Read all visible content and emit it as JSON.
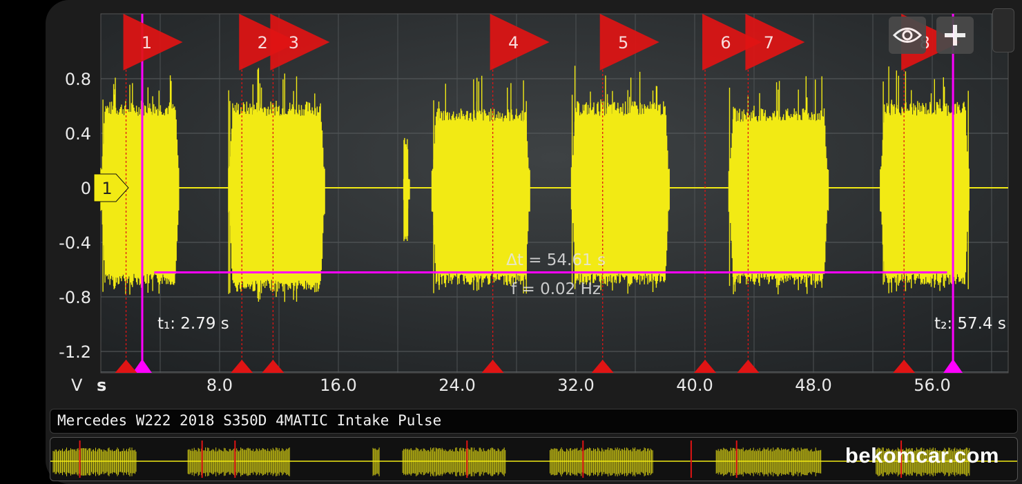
{
  "chart_data": {
    "type": "line",
    "subtype": "oscilloscope",
    "title": "Mercedes W222 2018 S350D 4MATIC Intake Pulse",
    "y_unit": "V",
    "x_unit": "s",
    "ylim": [
      -1.4,
      1.25
    ],
    "xlim": [
      0,
      61
    ],
    "y_ticks": [
      0.8,
      0.4,
      0,
      -0.4,
      -0.8,
      -1.2
    ],
    "y_tick_labels": [
      "0.8",
      "0.4",
      "0",
      "-0.4",
      "-0.8",
      "-1.2"
    ],
    "x_ticks": [
      8,
      16,
      24,
      32,
      40,
      48,
      56
    ],
    "x_tick_labels": [
      "8.0",
      "16.0",
      "24.0",
      "32.0",
      "40.0",
      "48.0",
      "56.0"
    ],
    "grid": true,
    "series_color": "#f2ea14",
    "baseline_offset": 0,
    "bursts": [
      {
        "start": 0,
        "end": 5.3,
        "amplitude_pos": 0.6,
        "amplitude_neg": -0.7
      },
      {
        "start": 8.6,
        "end": 15.1,
        "amplitude_pos": 0.6,
        "amplitude_neg": -0.75
      },
      {
        "start": 20.4,
        "end": 20.8,
        "amplitude_pos": 0.25,
        "amplitude_neg": -0.35
      },
      {
        "start": 22.3,
        "end": 28.9,
        "amplitude_pos": 0.55,
        "amplitude_neg": -0.7
      },
      {
        "start": 31.7,
        "end": 38.3,
        "amplitude_pos": 0.6,
        "amplitude_neg": -0.7
      },
      {
        "start": 42.3,
        "end": 49.0,
        "amplitude_pos": 0.55,
        "amplitude_neg": -0.7
      },
      {
        "start": 52.5,
        "end": 58.5,
        "amplitude_pos": 0.6,
        "amplitude_neg": -0.7
      }
    ],
    "markers": [
      {
        "label": "1",
        "x": 1.7
      },
      {
        "label": "2",
        "x": 9.5
      },
      {
        "label": "3",
        "x": 11.6
      },
      {
        "label": "4",
        "x": 26.4
      },
      {
        "label": "5",
        "x": 33.8
      },
      {
        "label": "6",
        "x": 40.7
      },
      {
        "label": "7",
        "x": 43.6
      },
      {
        "label": "8",
        "x": 54.1
      }
    ],
    "marker_color": "#e01414",
    "cursors": {
      "color": "#ff00ff",
      "t1": {
        "x": 2.79,
        "label": "t₁: 2.79 s"
      },
      "t2": {
        "x": 57.4,
        "label": "t₂: 57.4 s"
      },
      "measurement_level": -0.62,
      "delta_t": "Δt = 54.61 s",
      "frequency": "f = 0.02 Hz"
    },
    "channel_marker": {
      "label": "1",
      "level": 0
    }
  },
  "axes": {
    "y_unit_label": "V",
    "x_unit_label": "s"
  },
  "title_bar": {
    "text": "Mercedes W222 2018 S350D 4MATIC Intake Pulse"
  },
  "overview": {
    "watermark": "bekomcar.com"
  },
  "controls": {
    "eye_icon": "eye-icon",
    "add_icon": "plus-icon"
  }
}
